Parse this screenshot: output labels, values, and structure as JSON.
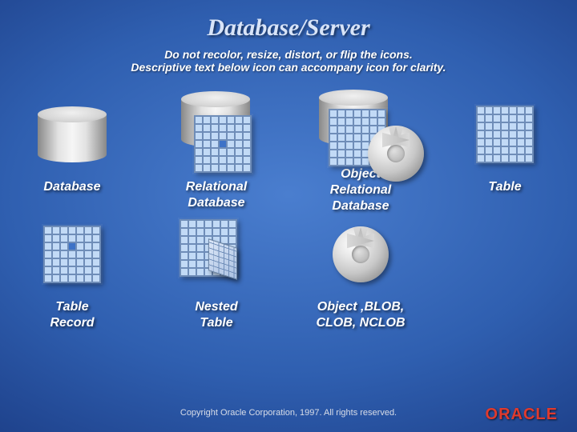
{
  "title": "Database/Server",
  "subtitle1": "Do not recolor, resize, distort, or flip the icons.",
  "subtitle2": "Descriptive text below icon can accompany icon for clarity.",
  "items": [
    {
      "label": "Database"
    },
    {
      "label": "Relational\nDatabase"
    },
    {
      "label": "Object\nRelational\nDatabase"
    },
    {
      "label": "Table"
    },
    {
      "label": "Table\nRecord"
    },
    {
      "label": "Nested\nTable"
    },
    {
      "label": "Object ‚BLOB,\nCLOB, NCLOB"
    }
  ],
  "copyright": "Copyright  Oracle Corporation, 1997. All rights reserved.",
  "logo_text": "ORACLE",
  "colors": {
    "brand_red": "#e03a2d"
  }
}
